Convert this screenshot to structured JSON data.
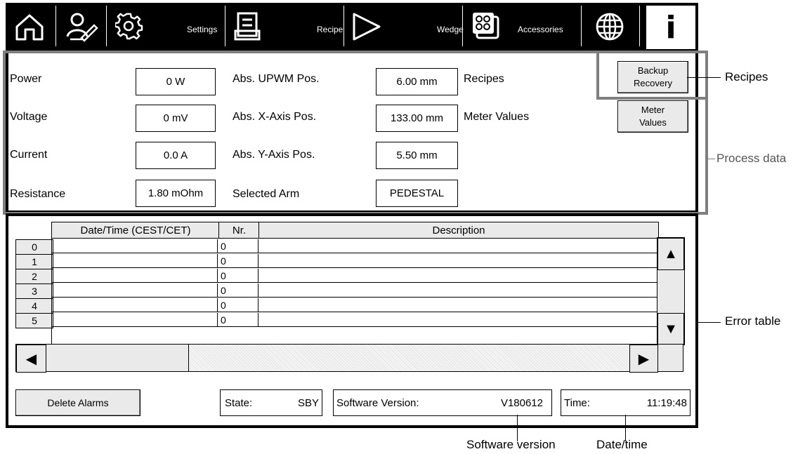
{
  "toolbar": {
    "items": [
      {
        "icon": "home-icon"
      },
      {
        "icon": "user-edit-icon"
      },
      {
        "icon": "gear-icon",
        "label": "Settings"
      },
      {
        "icon": "recipe-icon",
        "label": "Recipe"
      },
      {
        "icon": "play-triangle-icon",
        "label": "Wedge"
      },
      {
        "icon": "accessories-icon",
        "label": "Accessories"
      },
      {
        "icon": "globe-icon"
      }
    ],
    "info_label": "i"
  },
  "process": {
    "col1": [
      {
        "label": "Power",
        "value": "0  W"
      },
      {
        "label": "Voltage",
        "value": "0 mV"
      },
      {
        "label": "Current",
        "value": "0.0 A"
      },
      {
        "label": "Resistance",
        "value": "1.80 mOhm"
      }
    ],
    "col2": [
      {
        "label": "Abs. UPWM Pos.",
        "value": "6.00  mm"
      },
      {
        "label": "Abs. X-Axis Pos.",
        "value": "133.00  mm"
      },
      {
        "label": "Abs. Y-Axis Pos.",
        "value": "5.50  mm"
      },
      {
        "label": "Selected Arm",
        "value": "PEDESTAL"
      }
    ],
    "col3": [
      "Recipes",
      "Meter Values"
    ],
    "backup_button": {
      "line1": "Backup",
      "line2": "Recovery"
    },
    "meter_button": {
      "line1": "Meter",
      "line2": "Values"
    }
  },
  "error_table": {
    "headers": [
      "Date/Time (CEST/CET)",
      "Nr.",
      "Description"
    ],
    "rows": [
      {
        "idx": "0",
        "datetime": "",
        "nr": "0",
        "desc": ""
      },
      {
        "idx": "1",
        "datetime": "",
        "nr": "0",
        "desc": ""
      },
      {
        "idx": "2",
        "datetime": "",
        "nr": "0",
        "desc": ""
      },
      {
        "idx": "3",
        "datetime": "",
        "nr": "0",
        "desc": ""
      },
      {
        "idx": "4",
        "datetime": "",
        "nr": "0",
        "desc": ""
      },
      {
        "idx": "5",
        "datetime": "",
        "nr": "0",
        "desc": ""
      }
    ]
  },
  "footer": {
    "delete_button": "Delete Alarms",
    "state_label": "State:",
    "state_value": "SBY",
    "sw_label": "Software Version:",
    "sw_value": "V180612",
    "time_label": "Time:",
    "time_value": "11:19:48"
  },
  "annotations": {
    "recipes": "Recipes",
    "process_data": "Process data",
    "error_table": "Error table",
    "software_version": "Software version",
    "date_time": "Date/time"
  },
  "colors": {
    "frame_gray": "#7f7f7f",
    "bar_black": "#000000",
    "button_gray": "#eaeaea"
  }
}
